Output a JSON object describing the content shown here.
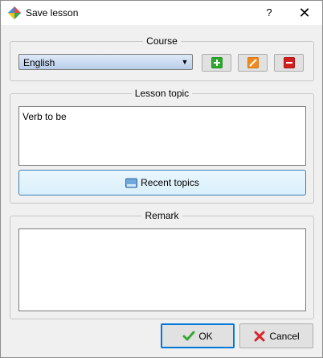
{
  "window": {
    "title": "Save lesson",
    "help_label": "?",
    "close_label": "✕"
  },
  "course": {
    "group_title": "Course",
    "selected": "English",
    "tools": [
      {
        "name": "add-course-button",
        "icon": "plus-icon",
        "color": "#2da82d"
      },
      {
        "name": "edit-course-button",
        "icon": "pencil-icon",
        "color": "#f08a1e"
      },
      {
        "name": "delete-course-button",
        "icon": "minus-icon",
        "color": "#d21e1e"
      }
    ]
  },
  "lesson_topic": {
    "group_title": "Lesson topic",
    "value": "Verb to be",
    "recent_label": "Recent topics"
  },
  "remark": {
    "group_title": "Remark",
    "value": ""
  },
  "footer": {
    "ok_label": "OK",
    "cancel_label": "Cancel"
  },
  "colors": {
    "accent": "#0078d7",
    "ok_check": "#37a835",
    "cancel_x": "#d9262c"
  }
}
